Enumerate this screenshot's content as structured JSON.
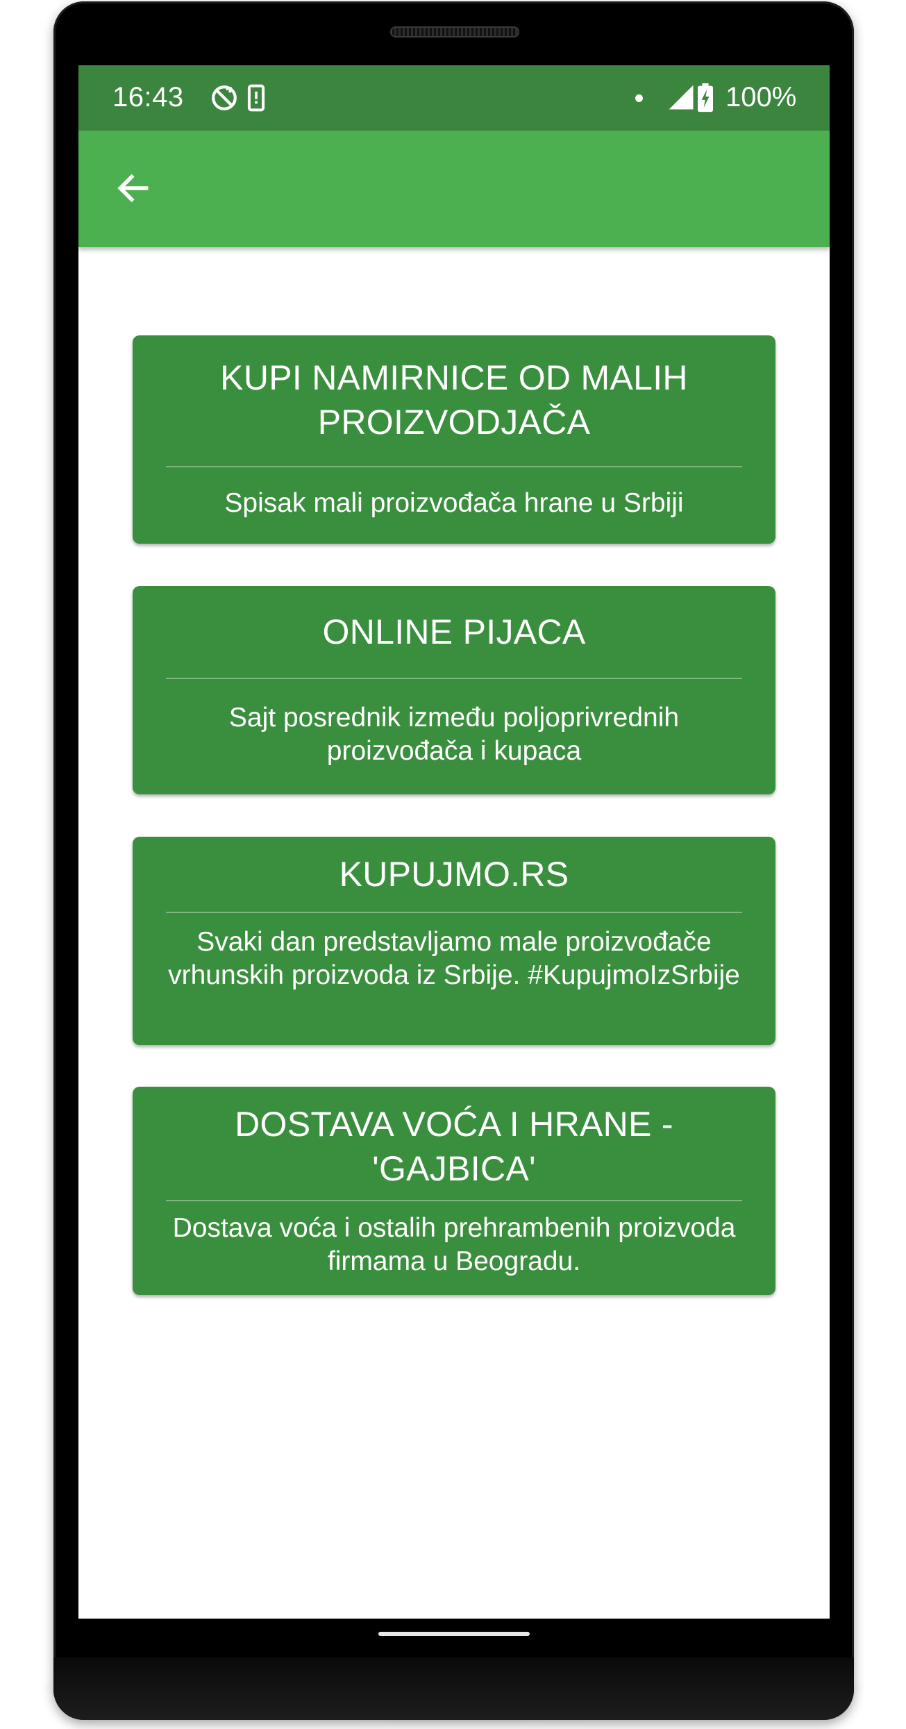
{
  "status_bar": {
    "time": "16:43",
    "battery_percent": "100%",
    "icons": [
      "sync-off-icon",
      "phone-vibrate-icon",
      "notification-dot-icon",
      "cell-signal-icon",
      "battery-charging-icon"
    ]
  },
  "app_bar": {
    "back_icon": "arrow-back-icon"
  },
  "cards": [
    {
      "title": "KUPI NAMIRNICE OD MALIH PROIZVODJAČA",
      "description": "Spisak mali proizvođača hrane u Srbiji"
    },
    {
      "title": "ONLINE PIJACA",
      "description": "Sajt posrednik između poljoprivrednih proizvođača i kupaca"
    },
    {
      "title": "KUPUJMO.RS",
      "description": "Svaki dan predstavljamo male proizvođače vrhunskih proizvoda iz Srbije. #KupujmoIzSrbije"
    },
    {
      "title": "DOSTAVA VOĆA I HRANE - 'GAJBICA'",
      "description": "Dostava voća i ostalih prehrambenih proizvoda firmama u Beogradu."
    }
  ],
  "colors": {
    "status_bar": "#3b853f",
    "app_bar": "#4cb050",
    "card": "#3a8f3e",
    "text": "#ffffff",
    "background": "#ffffff",
    "device": "#000000"
  }
}
